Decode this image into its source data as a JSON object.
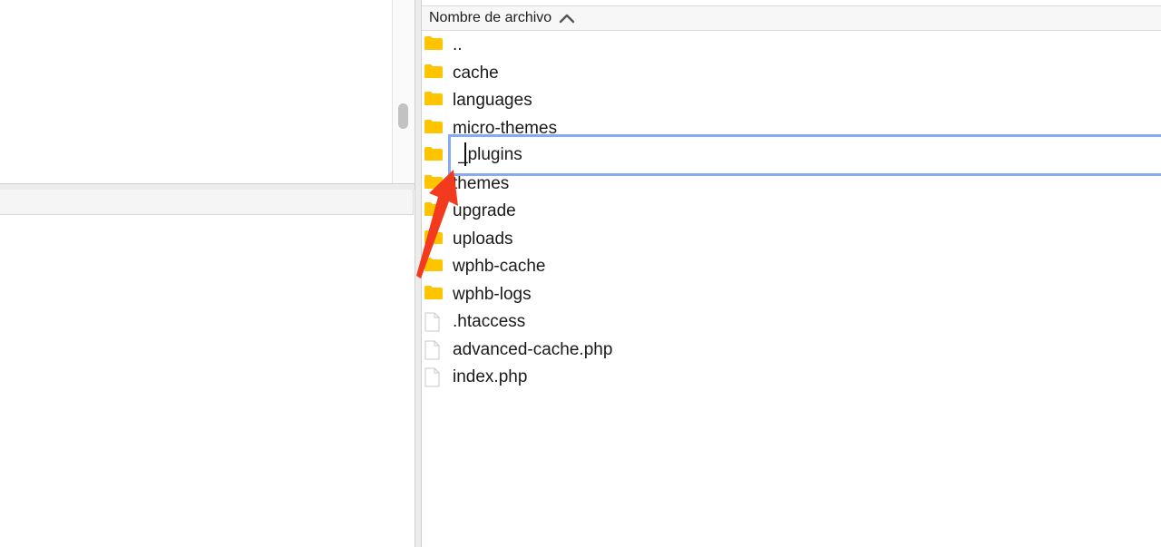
{
  "file_pane": {
    "column_header": "Nombre de archivo",
    "sort_icon": "chevron-up-icon",
    "items": [
      {
        "name": "..",
        "type": "folder"
      },
      {
        "name": "cache",
        "type": "folder"
      },
      {
        "name": "languages",
        "type": "folder"
      },
      {
        "name": "micro-themes",
        "type": "folder"
      },
      {
        "name": "",
        "type": "folder"
      },
      {
        "name": "themes",
        "type": "folder"
      },
      {
        "name": "upgrade",
        "type": "folder"
      },
      {
        "name": "uploads",
        "type": "folder"
      },
      {
        "name": "wphb-cache",
        "type": "folder"
      },
      {
        "name": "wphb-logs",
        "type": "folder"
      },
      {
        "name": ".htaccess",
        "type": "file"
      },
      {
        "name": "advanced-cache.php",
        "type": "file"
      },
      {
        "name": "index.php",
        "type": "file"
      }
    ],
    "rename": {
      "value": "_plugins"
    }
  },
  "colors": {
    "folder": "#FFC400",
    "rename_border": "#87AAF2",
    "annotation_arrow": "#F23A1F"
  },
  "annotation": {
    "icon": "red-arrow-icon"
  }
}
